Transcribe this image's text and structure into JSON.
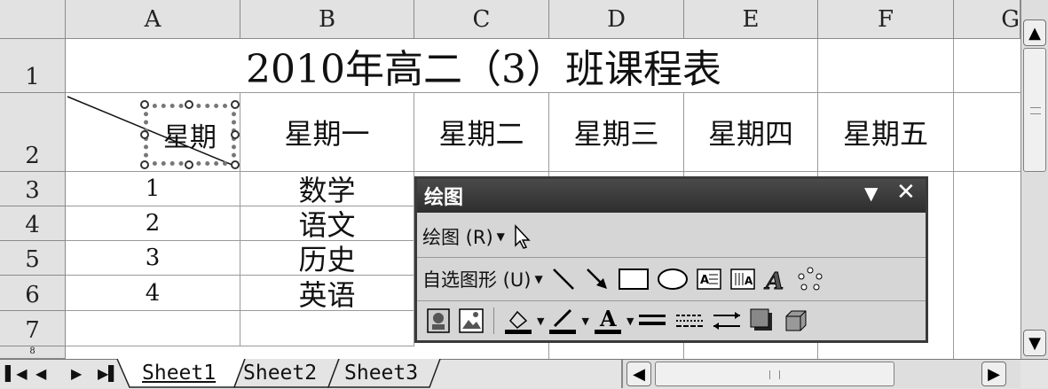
{
  "columns": [
    "A",
    "B",
    "C",
    "D",
    "E",
    "F",
    "G"
  ],
  "rows": [
    "1",
    "2",
    "3",
    "4",
    "5",
    "6",
    "7",
    "8"
  ],
  "title": "2010年高二（3）班课程表",
  "header_row": {
    "corner": "星期",
    "days": [
      "星期一",
      "星期二",
      "星期三",
      "星期四",
      "星期五"
    ]
  },
  "body_rows": [
    {
      "num": "1",
      "subject": "数学"
    },
    {
      "num": "2",
      "subject": "语文"
    },
    {
      "num": "3",
      "subject": "历史"
    },
    {
      "num": "4",
      "subject": "英语"
    }
  ],
  "sheet_tabs": [
    "Sheet1",
    "Sheet2",
    "Sheet3"
  ],
  "active_tab": "Sheet1",
  "drawing_toolbar": {
    "title": "绘图",
    "draw_menu": "绘图 (R)",
    "autoshapes_menu": "自选图形 (U)",
    "icons": [
      "select-objects",
      "line",
      "arrow",
      "rectangle",
      "oval",
      "text-box",
      "vertical-text-box",
      "wordart",
      "diagram",
      "clip-art",
      "picture",
      "fill-color",
      "line-color",
      "font-color",
      "line-style",
      "dash-style",
      "arrow-style",
      "shadow-style",
      "3d-style"
    ]
  },
  "colors": {
    "header_bg": "#e2e2e2",
    "toolbar_title": "#3a3a3a",
    "toolbar_bg": "#d6d6d6"
  }
}
